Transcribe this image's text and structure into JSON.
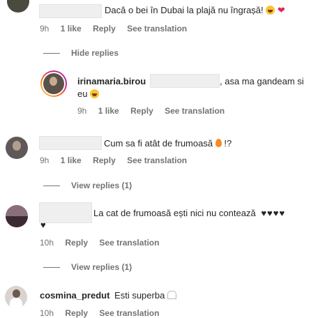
{
  "comments": [
    {
      "text_pre": "Dacă o bei în Dubai la plajă nu îngrașă!",
      "time": "9h",
      "likes": "1 like",
      "reply": "Reply",
      "translate": "See translation"
    },
    {
      "toggle": "Hide replies"
    },
    {
      "username": "irinamaria.birou",
      "text_suffix": ", asa ma gandeam si",
      "text_line2": "eu",
      "time": "9h",
      "likes": "1 like",
      "reply": "Reply",
      "translate": "See translation"
    },
    {
      "text": "Cum sa fi atât de frumoasă",
      "text_end": "!?",
      "time": "9h",
      "likes": "1 like",
      "reply": "Reply",
      "translate": "See translation"
    },
    {
      "toggle": "View replies (1)"
    },
    {
      "text": "La cat de frumoasă ești nici nu contează",
      "hearts": "♥♥♥♥",
      "heart_line2": "♥",
      "time": "10h",
      "reply": "Reply",
      "translate": "See translation"
    },
    {
      "toggle": "View replies (1)"
    },
    {
      "username": "cosmina_predut",
      "text": "Esti superba",
      "time": "10h",
      "reply": "Reply",
      "translate": "See translation"
    }
  ],
  "colors": {
    "text": "#262626",
    "muted": "#737373",
    "heart": "#e0245e",
    "ring_start": "#feda75",
    "ring_end": "#d62976"
  },
  "icons": [
    "laugh-emoji-icon",
    "red-heart-icon",
    "fire-emoji-icon",
    "black-heart-icon",
    "white-heart-icon",
    "avatar"
  ]
}
